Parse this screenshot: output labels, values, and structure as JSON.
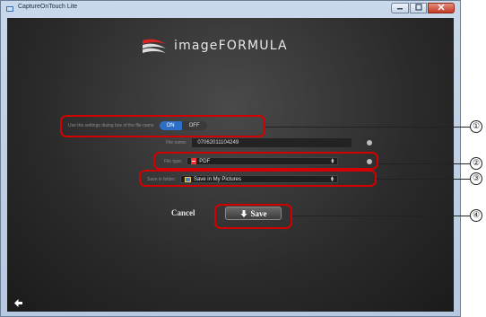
{
  "window": {
    "title": "CaptureOnTouch Lite"
  },
  "logo": {
    "text": "imageFORMULA"
  },
  "file_name_setting": {
    "label": "Use the settings dialog box of the file name",
    "on": "ON",
    "off": "OFF"
  },
  "file_name": {
    "label": "File name:",
    "value": "07062011104249"
  },
  "file_type": {
    "label": "File type:",
    "value": "PDF"
  },
  "save_folder": {
    "label": "Save in folder:",
    "value": "Save in My Pictures"
  },
  "actions": {
    "cancel": "Cancel",
    "save": "Save"
  },
  "callouts": [
    "①",
    "②",
    "③",
    "④"
  ],
  "colors": {
    "callout": "#d40000",
    "toggle_on": "#2d6ec6",
    "background": "#2a2a2a"
  }
}
